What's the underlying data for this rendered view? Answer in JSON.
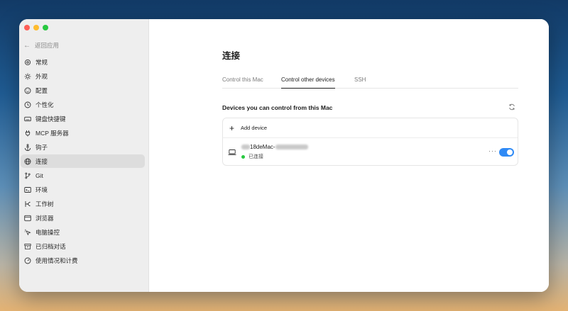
{
  "sidebar": {
    "back_label": "返回应用",
    "items": [
      {
        "label": "常规",
        "icon": "gear-icon",
        "active": false
      },
      {
        "label": "外观",
        "icon": "sun-icon",
        "active": false
      },
      {
        "label": "配置",
        "icon": "smiley-icon",
        "active": false
      },
      {
        "label": "个性化",
        "icon": "clock-icon",
        "active": false
      },
      {
        "label": "键盘快捷键",
        "icon": "keyboard-icon",
        "active": false
      },
      {
        "label": "MCP 服务器",
        "icon": "plug-icon",
        "active": false
      },
      {
        "label": "钩子",
        "icon": "anchor-icon",
        "active": false
      },
      {
        "label": "连接",
        "icon": "globe-icon",
        "active": true
      },
      {
        "label": "Git",
        "icon": "git-branch-icon",
        "active": false
      },
      {
        "label": "环境",
        "icon": "terminal-icon",
        "active": false
      },
      {
        "label": "工作树",
        "icon": "worktree-icon",
        "active": false
      },
      {
        "label": "浏览器",
        "icon": "browser-icon",
        "active": false
      },
      {
        "label": "电脑操控",
        "icon": "cursor-icon",
        "active": false
      },
      {
        "label": "已归档对话",
        "icon": "archive-icon",
        "active": false
      },
      {
        "label": "使用情况和计费",
        "icon": "gauge-icon",
        "active": false
      }
    ]
  },
  "main": {
    "title": "连接",
    "tabs": [
      {
        "label": "Control this Mac",
        "active": false
      },
      {
        "label": "Control other devices",
        "active": true
      },
      {
        "label": "SSH",
        "active": false
      }
    ],
    "section_title": "Devices you can control from this Mac",
    "add_device_label": "Add device",
    "device": {
      "name_visible": "18deMac-",
      "status": "已连接",
      "status_color": "#28c840",
      "enabled": true,
      "more_label": "···"
    }
  },
  "colors": {
    "accent": "#2f8af5",
    "traffic_red": "#fe5f57",
    "traffic_yellow": "#febc2e",
    "traffic_green": "#28c840"
  }
}
